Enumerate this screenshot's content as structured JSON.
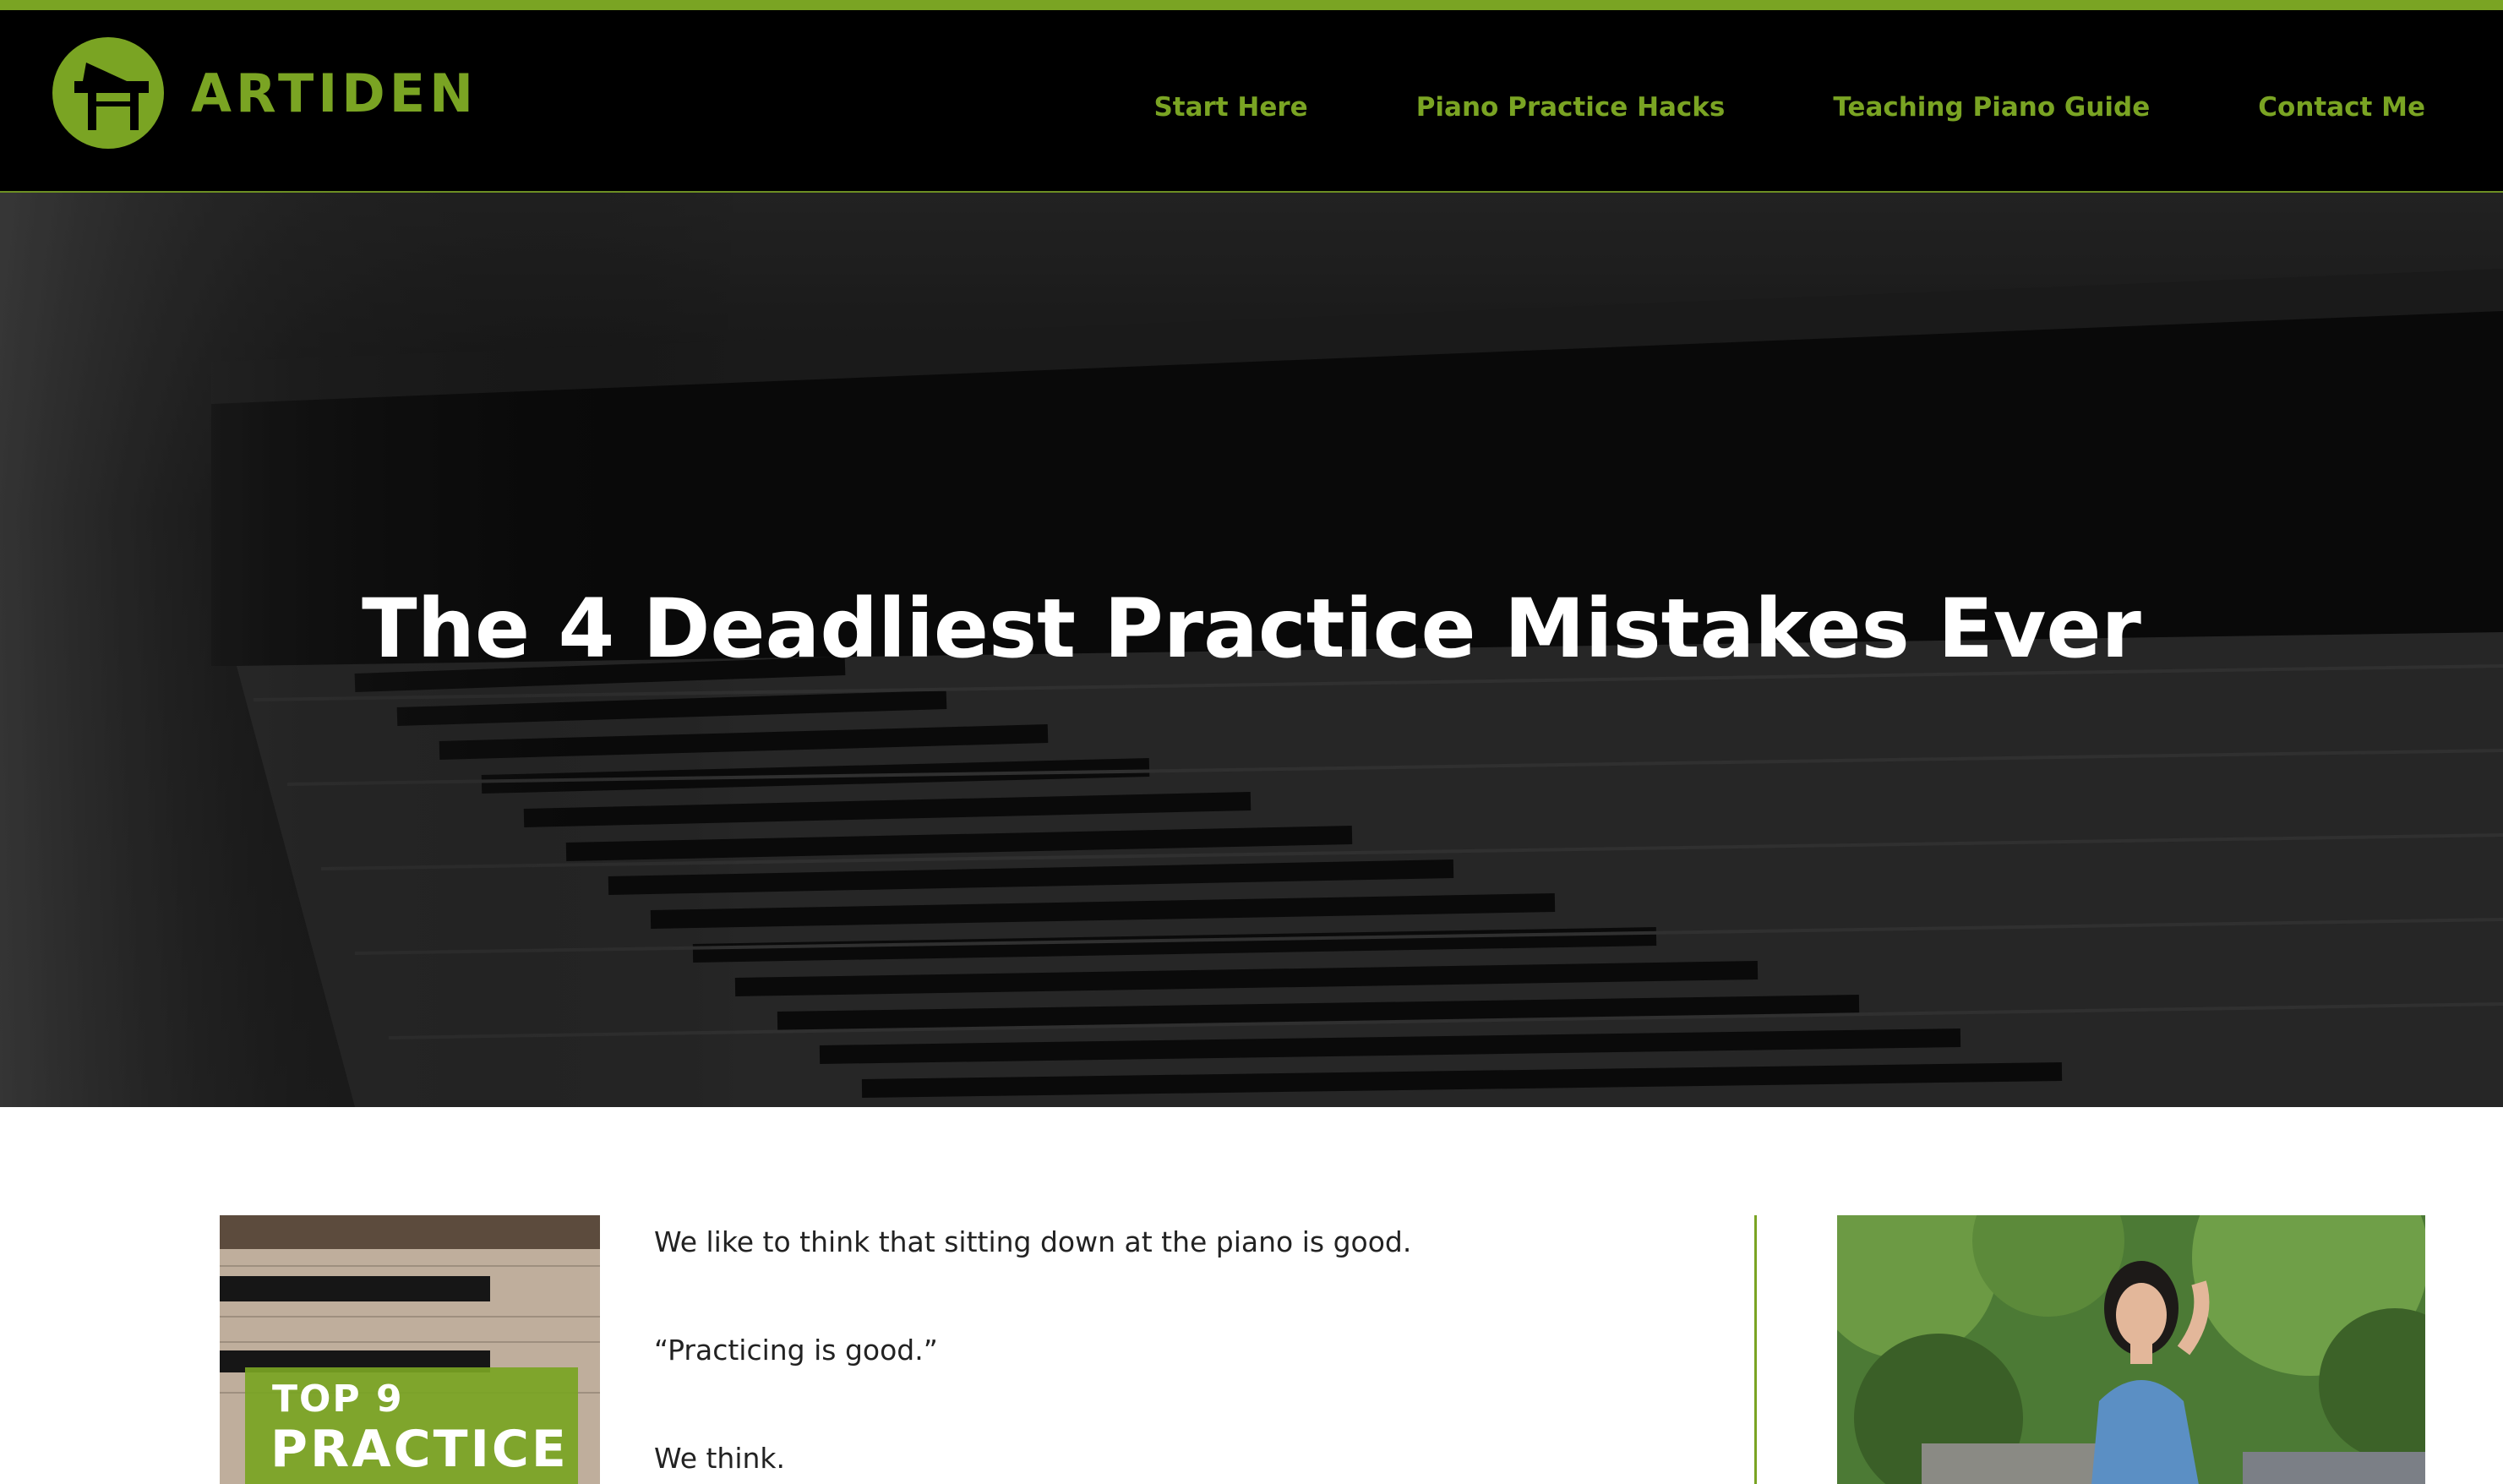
{
  "site": {
    "name": "ARTIDEN",
    "logo_icon": "grand-piano-icon",
    "accent_color": "#7aa423"
  },
  "nav": {
    "items": [
      {
        "label": "Start Here"
      },
      {
        "label": "Piano Practice Hacks"
      },
      {
        "label": "Teaching Piano Guide"
      },
      {
        "label": "Contact Me"
      }
    ]
  },
  "hero": {
    "title": "The 4 Deadliest Practice Mistakes Ever"
  },
  "ebook": {
    "top_line": "TOP 9",
    "main_line": "PRACTICE"
  },
  "article": {
    "paragraphs": [
      "We like to think that sitting down at the piano is good.",
      "“Practicing is good.”",
      "We think."
    ]
  },
  "sidebar": {
    "photo_icon": "author-portrait"
  }
}
